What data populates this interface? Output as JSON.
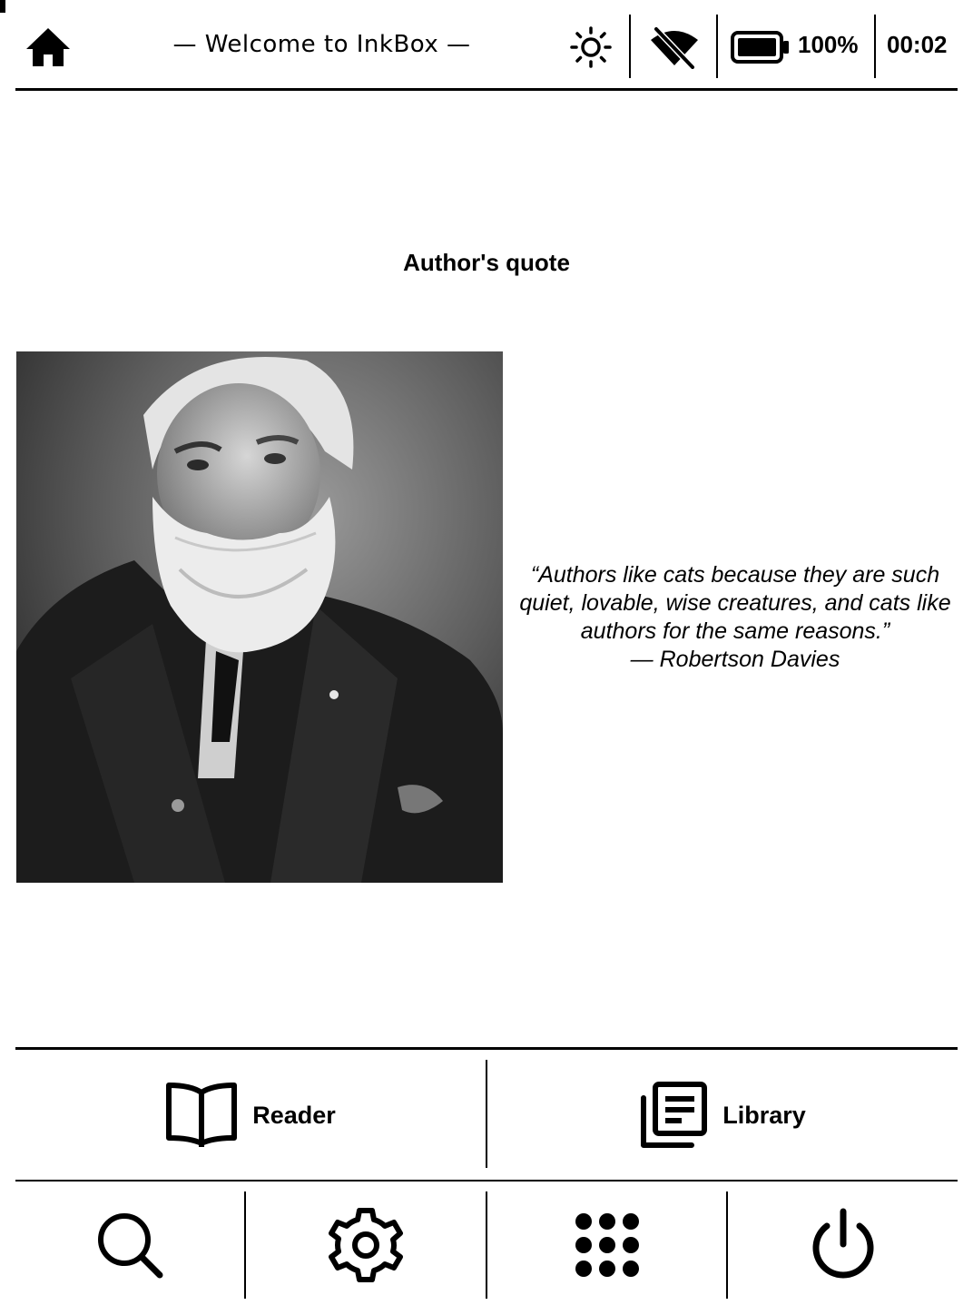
{
  "statusbar": {
    "welcome": "— Welcome to InkBox —",
    "battery_percent": "100%",
    "battery_level": 1.0,
    "clock": "00:02",
    "icons": {
      "home": "home-icon",
      "brightness": "brightness-icon",
      "wifi": "wifi-off-icon",
      "battery": "battery-full-icon"
    }
  },
  "main": {
    "section_title": "Author's quote",
    "quote_text": "“Authors like cats because they are such quiet, lovable, wise creatures, and cats like authors for the same reasons.”",
    "quote_author": "— Robertson Davies"
  },
  "nav": {
    "reader_label": "Reader",
    "library_label": "Library",
    "tools": [
      "search-icon",
      "settings-icon",
      "apps-grid-icon",
      "power-icon"
    ]
  }
}
